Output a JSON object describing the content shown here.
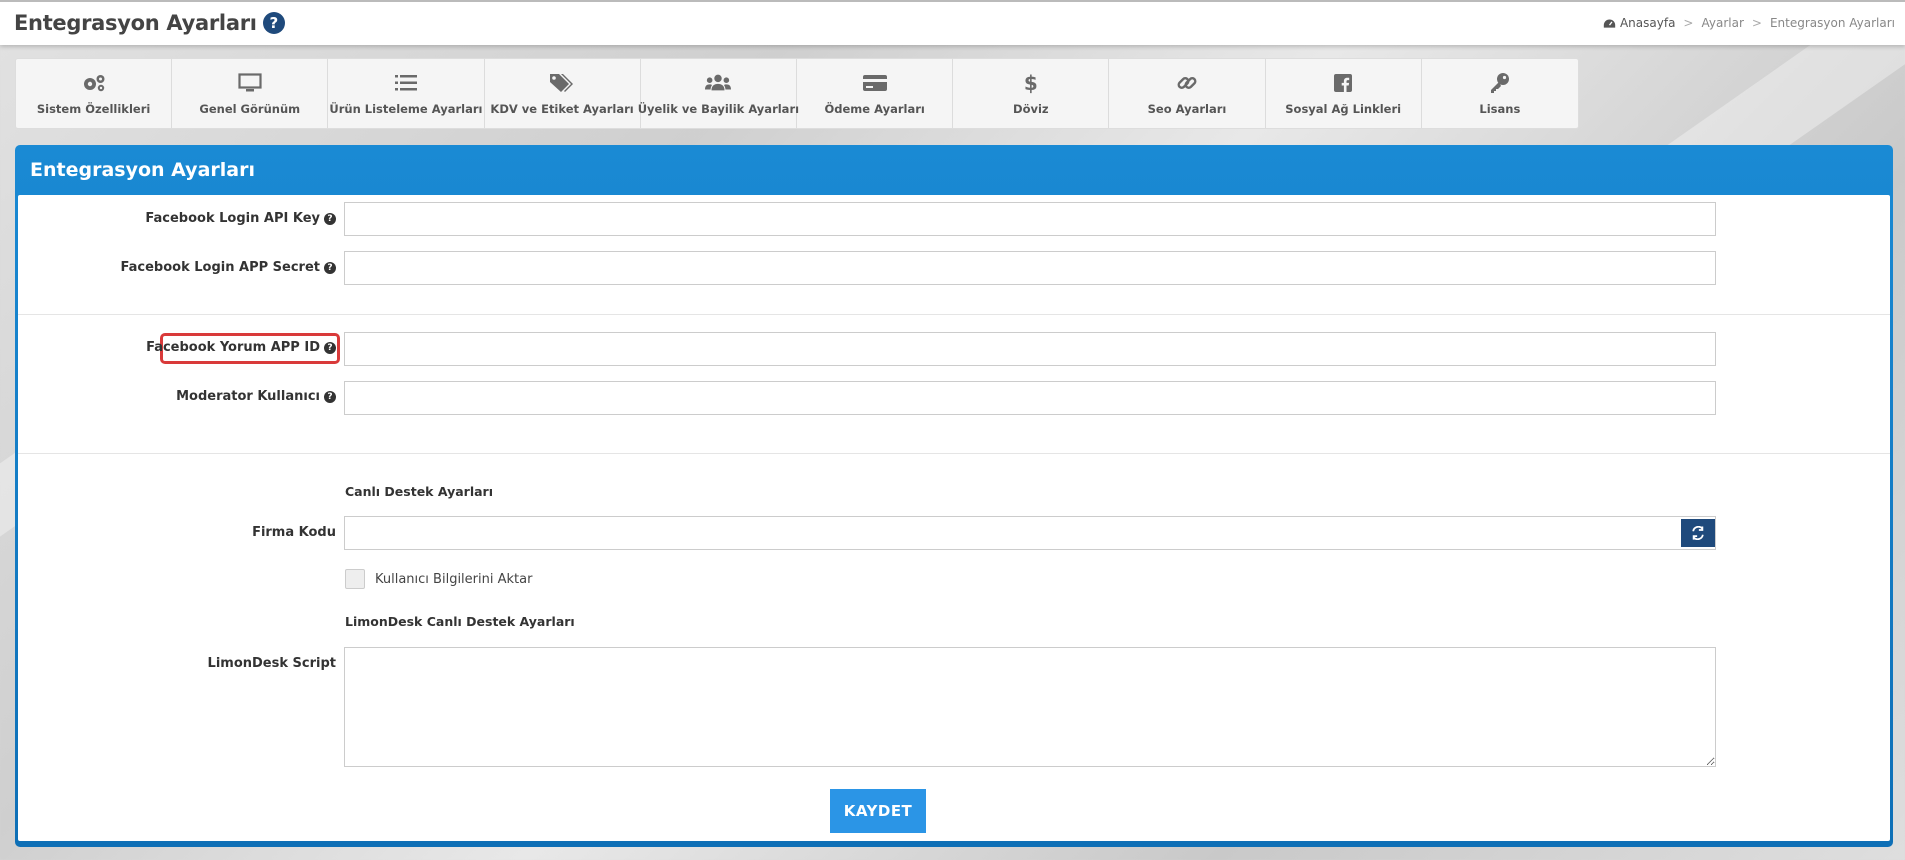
{
  "header": {
    "title": "Entegrasyon Ayarları",
    "breadcrumb": [
      "Anasayfa",
      "Ayarlar",
      "Entegrasyon Ayarları"
    ]
  },
  "tabs": [
    {
      "label": "Sistem Özellikleri",
      "icon": "gears-icon"
    },
    {
      "label": "Genel Görünüm",
      "icon": "monitor-icon"
    },
    {
      "label": "Ürün Listeleme Ayarları",
      "icon": "list-icon"
    },
    {
      "label": "KDV ve Etiket Ayarları",
      "icon": "tags-icon"
    },
    {
      "label": "Üyelik ve Bayilik Ayarları",
      "icon": "users-icon"
    },
    {
      "label": "Ödeme Ayarları",
      "icon": "credit-card-icon"
    },
    {
      "label": "Döviz",
      "icon": "dollar-icon"
    },
    {
      "label": "Seo Ayarları",
      "icon": "link-icon"
    },
    {
      "label": "Sosyal Ağ Linkleri",
      "icon": "facebook-icon"
    },
    {
      "label": "Lisans",
      "icon": "key-icon"
    }
  ],
  "panel": {
    "title": "Entegrasyon Ayarları",
    "fields": {
      "fb_login_api_key": {
        "label": "Facebook Login API Key",
        "value": ""
      },
      "fb_login_app_secret": {
        "label": "Facebook Login APP Secret",
        "value": ""
      },
      "fb_comment_app_id": {
        "label": "Facebook Yorum APP ID",
        "value": ""
      },
      "moderator_user": {
        "label": "Moderator Kullanıcı",
        "value": ""
      },
      "live_support_heading": "Canlı Destek Ayarları",
      "firm_code": {
        "label": "Firma Kodu",
        "value": ""
      },
      "transfer_user_info": {
        "label": "Kullanıcı Bilgilerini Aktar",
        "checked": false
      },
      "limondesk_heading": "LimonDesk Canlı Destek Ayarları",
      "limondesk_script": {
        "label": "LimonDesk Script",
        "value": ""
      }
    },
    "save_label": "KAYDET"
  },
  "colors": {
    "panel_blue": "#0e6fb6",
    "navy": "#1f4a7c",
    "save_blue": "#2b95e6",
    "highlight_red": "#d93a3a"
  }
}
